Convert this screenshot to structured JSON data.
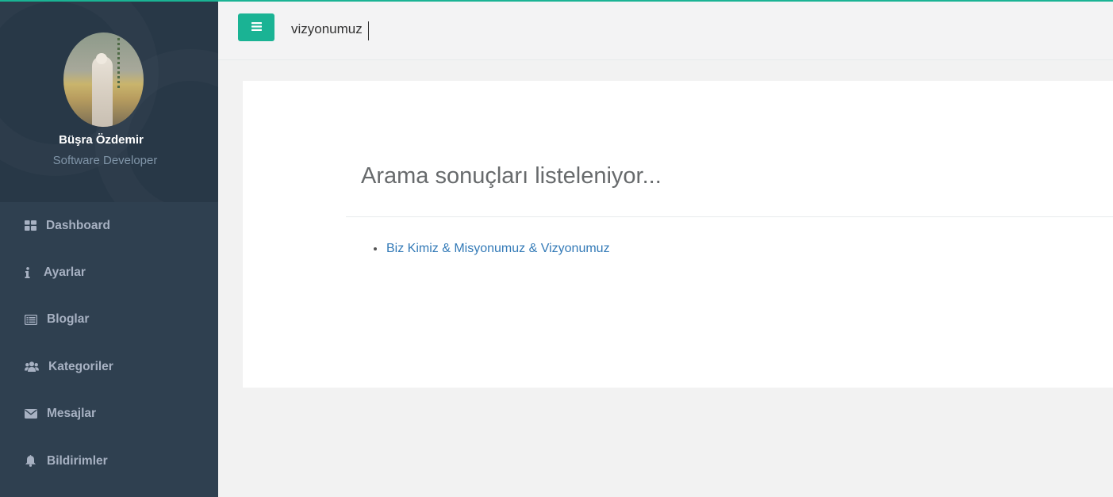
{
  "colors": {
    "accent": "#1ab394",
    "sidebar_bg": "#2f4050",
    "profile_bg": "#283847",
    "nav_text": "#a7b1c2",
    "link": "#337ab7"
  },
  "profile": {
    "name": "Büşra Özdemir",
    "role": "Software Developer"
  },
  "sidebar": {
    "items": [
      {
        "label": "Dashboard",
        "icon": "dashboard-icon"
      },
      {
        "label": "Ayarlar",
        "icon": "info-icon"
      },
      {
        "label": "Bloglar",
        "icon": "list-alt-icon"
      },
      {
        "label": "Kategoriler",
        "icon": "users-icon"
      },
      {
        "label": "Mesajlar",
        "icon": "envelope-icon"
      },
      {
        "label": "Bildirimler",
        "icon": "bell-icon"
      }
    ]
  },
  "topbar": {
    "menu_icon": "bars-icon",
    "search_value": "vizyonumuz"
  },
  "main": {
    "title": "Arama sonuçları listeleniyor...",
    "results": [
      {
        "label": "Biz Kimiz & Misyonumuz & Vizyonumuz"
      }
    ]
  }
}
